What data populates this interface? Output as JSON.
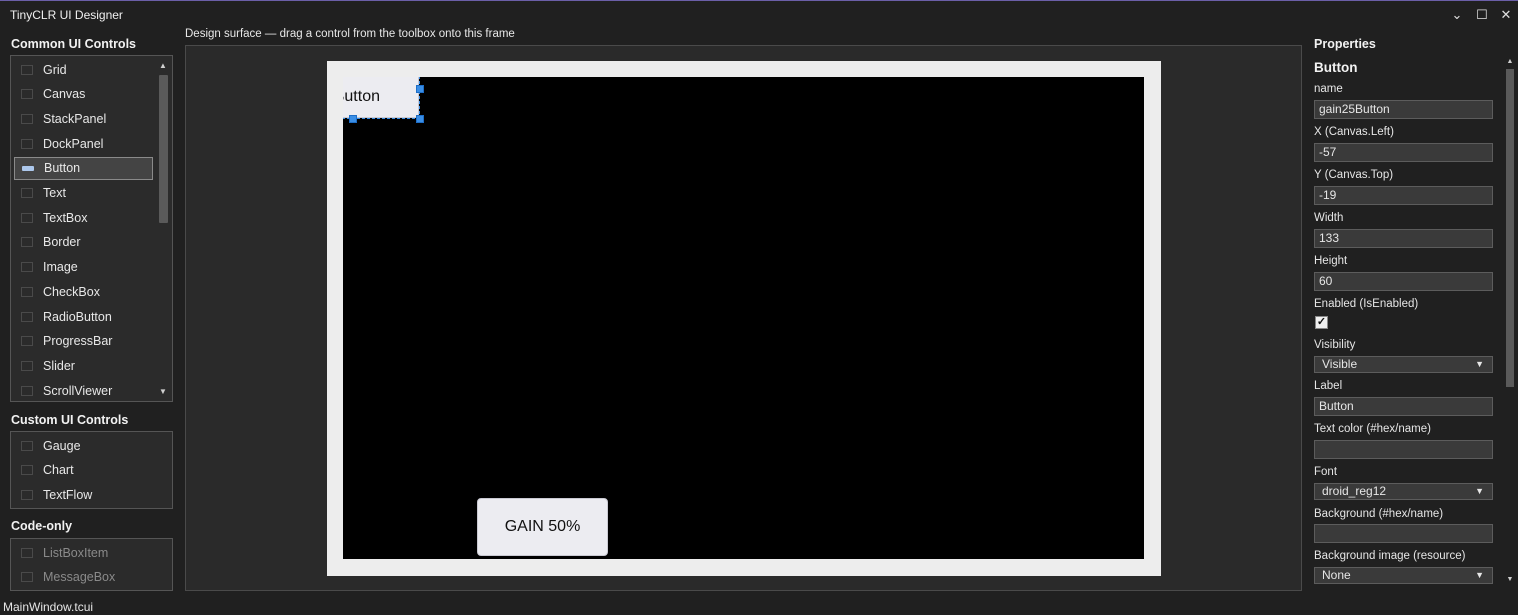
{
  "window": {
    "title": "TinyCLR UI Designer",
    "controls": {
      "minimize": "⌄",
      "maximize": "☐",
      "close": "✕"
    }
  },
  "toolbox": {
    "common_heading": "Common UI Controls",
    "common_items": [
      {
        "label": "Grid",
        "icon": "grid-icon"
      },
      {
        "label": "Canvas",
        "icon": "canvas-icon"
      },
      {
        "label": "StackPanel",
        "icon": "stackpanel-icon"
      },
      {
        "label": "DockPanel",
        "icon": "dockpanel-icon"
      },
      {
        "label": "Button",
        "icon": "button-icon",
        "selected": true
      },
      {
        "label": "Text",
        "icon": "text-icon"
      },
      {
        "label": "TextBox",
        "icon": "textbox-icon"
      },
      {
        "label": "Border",
        "icon": "border-icon"
      },
      {
        "label": "Image",
        "icon": "image-icon"
      },
      {
        "label": "CheckBox",
        "icon": "checkbox-icon"
      },
      {
        "label": "RadioButton",
        "icon": "radiobutton-icon"
      },
      {
        "label": "ProgressBar",
        "icon": "progressbar-icon"
      },
      {
        "label": "Slider",
        "icon": "slider-icon"
      },
      {
        "label": "ScrollViewer",
        "icon": "scrollviewer-icon"
      }
    ],
    "custom_heading": "Custom UI Controls",
    "custom_items": [
      {
        "label": "Gauge",
        "icon": "gauge-icon"
      },
      {
        "label": "Chart",
        "icon": "chart-icon"
      },
      {
        "label": "TextFlow",
        "icon": "textflow-icon"
      }
    ],
    "codeonly_heading": "Code-only",
    "codeonly_items": [
      {
        "label": "ListBoxItem",
        "icon": "listboxitem-icon"
      },
      {
        "label": "MessageBox",
        "icon": "messagebox-icon"
      }
    ]
  },
  "design": {
    "hint": "Design surface — drag a control from the toolbox onto this frame",
    "selected_button_text": "Button",
    "gain_button_text": "GAIN 50%"
  },
  "properties": {
    "title": "Properties",
    "type": "Button",
    "name_label": "name",
    "name_value": "gain25Button",
    "x_label": "X (Canvas.Left)",
    "x_value": "-57",
    "y_label": "Y (Canvas.Top)",
    "y_value": "-19",
    "width_label": "Width",
    "width_value": "133",
    "height_label": "Height",
    "height_value": "60",
    "enabled_label": "Enabled (IsEnabled)",
    "enabled_checked": true,
    "visibility_label": "Visibility",
    "visibility_value": "Visible",
    "label_label": "Label",
    "label_value": "Button",
    "textcolor_label": "Text color (#hex/name)",
    "textcolor_value": "",
    "font_label": "Font",
    "font_value": "droid_reg12",
    "background_label": "Background (#hex/name)",
    "background_value": "",
    "bgimage_label": "Background image (resource)",
    "bgimage_value": "None"
  },
  "status": {
    "file": "MainWindow.tcui"
  }
}
